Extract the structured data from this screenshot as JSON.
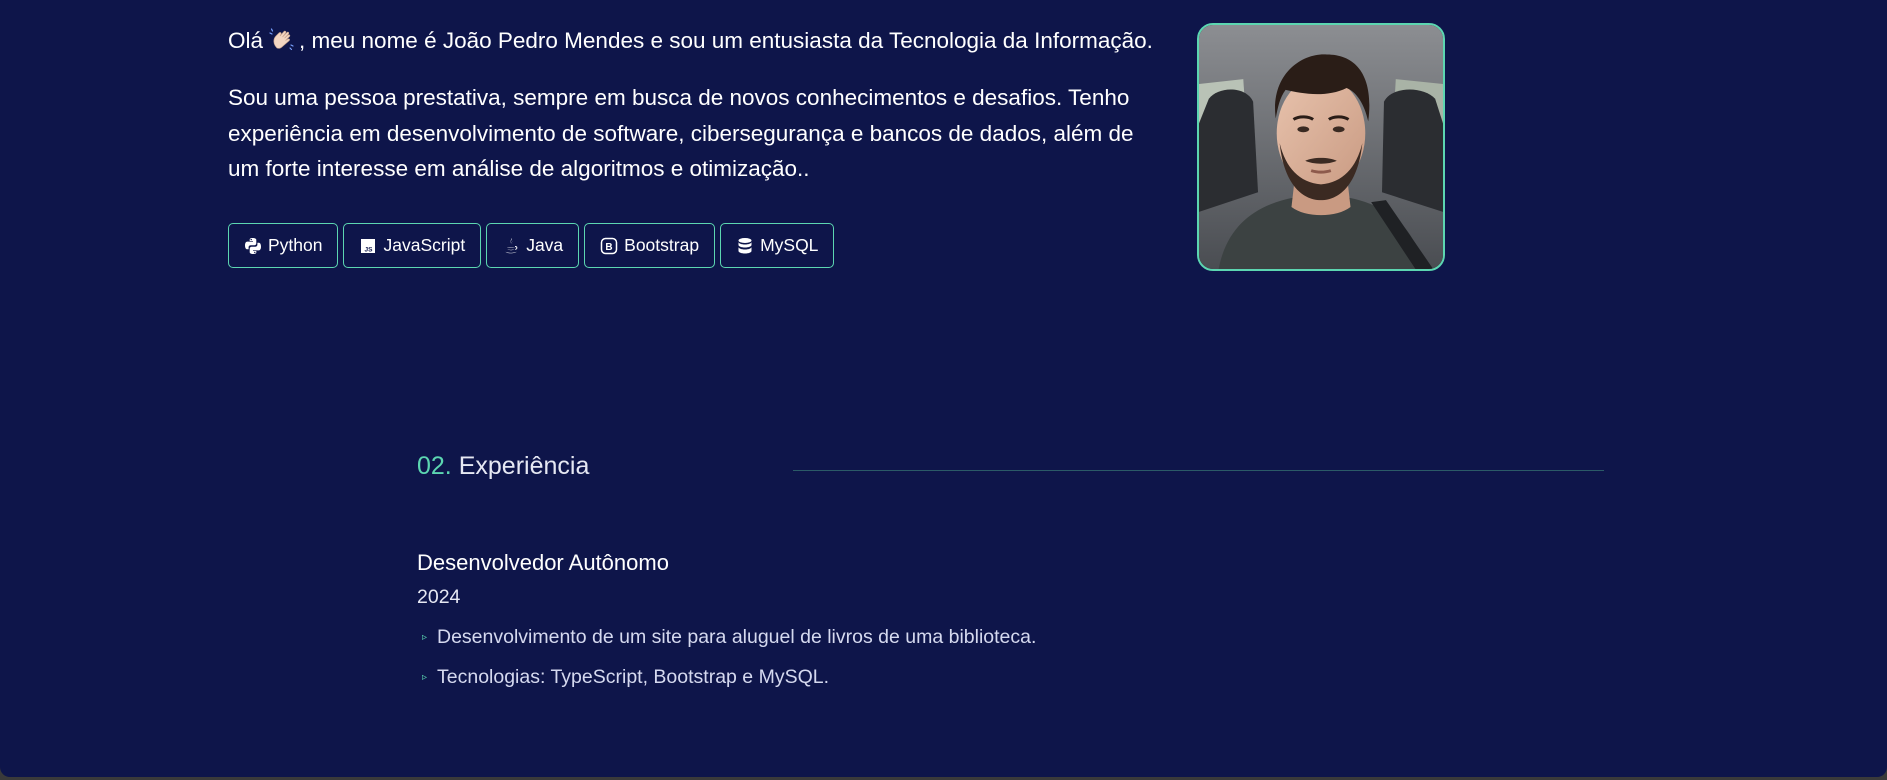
{
  "about": {
    "intro_before": "Olá",
    "intro_after": ", meu nome é João Pedro Mendes e sou um entusiasta da Tecnologia da Informação.",
    "wave_icon": "waving-hand-icon",
    "bio": "Sou uma pessoa prestativa, sempre em busca de novos conhecimentos e desafios. Tenho experiência em desenvolvimento de software, cibersegurança e bancos de dados, além de um forte interesse em análise de algoritmos e otimização..",
    "skills": [
      {
        "label": "Python",
        "icon": "python-icon"
      },
      {
        "label": "JavaScript",
        "icon": "javascript-icon"
      },
      {
        "label": "Java",
        "icon": "java-icon"
      },
      {
        "label": "Bootstrap",
        "icon": "bootstrap-icon"
      },
      {
        "label": "MySQL",
        "icon": "database-icon"
      }
    ]
  },
  "experience": {
    "number": "02.",
    "title": "Experiência",
    "jobs": [
      {
        "role": "Desenvolvedor Autônomo",
        "year": "2024",
        "items": [
          "Desenvolvimento de um site para aluguel de livros de uma biblioteca.",
          "Tecnologias: TypeScript, Bootstrap e MySQL."
        ]
      }
    ]
  },
  "colors": {
    "background": "#0e154a",
    "accent": "#5cd6b1",
    "text": "#ffffff"
  }
}
